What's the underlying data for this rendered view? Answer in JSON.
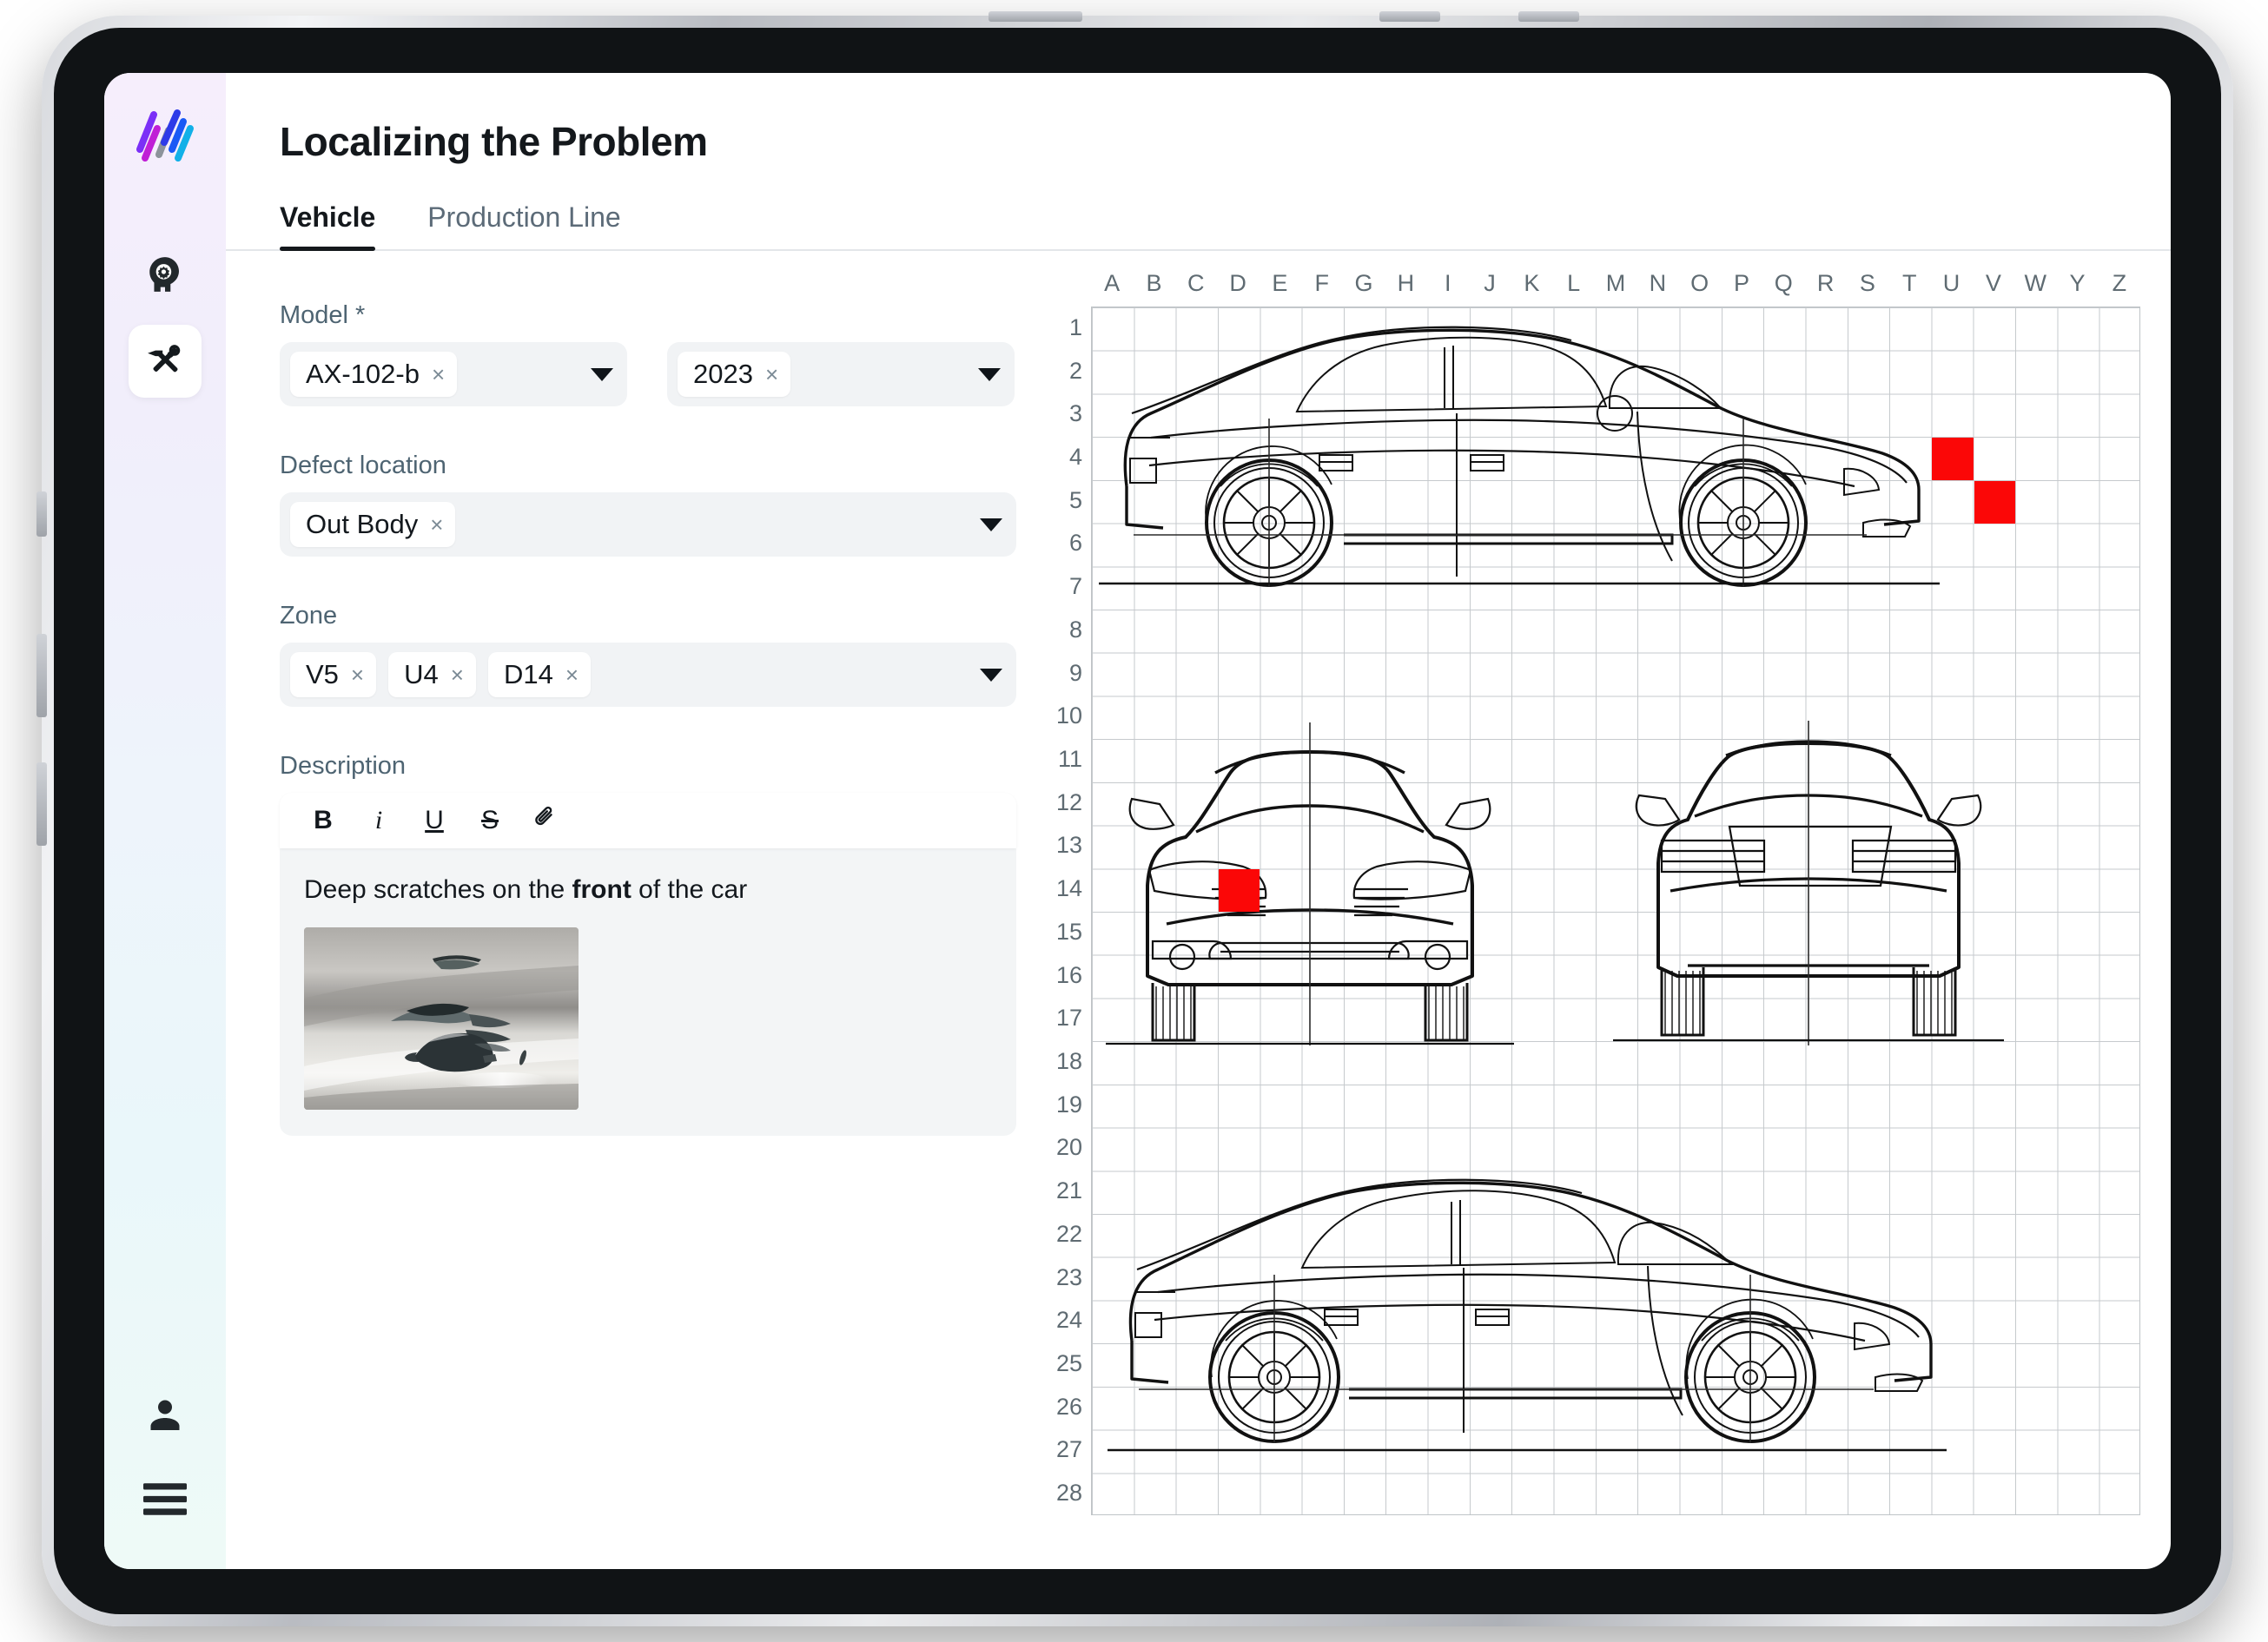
{
  "app": {
    "logo": "logo-mark",
    "page_title": "Localizing the Problem"
  },
  "sidebar": {
    "items": [
      {
        "name": "ai-assist",
        "icon": "head-gear-icon",
        "active": false
      },
      {
        "name": "tools",
        "icon": "tools-icon",
        "active": true
      },
      {
        "name": "account",
        "icon": "person-icon",
        "active": false
      },
      {
        "name": "menu",
        "icon": "hamburger-menu-icon",
        "active": false
      }
    ]
  },
  "tabs": [
    {
      "label": "Vehicle",
      "active": true
    },
    {
      "label": "Production Line",
      "active": false
    }
  ],
  "form": {
    "model": {
      "label": "Model *",
      "chips": [
        "AX-102-b"
      ],
      "remove_symbol": "×"
    },
    "year": {
      "label": "",
      "chips": [
        "2023"
      ],
      "remove_symbol": "×"
    },
    "defect_location": {
      "label": "Defect location",
      "chips": [
        "Out Body"
      ],
      "remove_symbol": "×"
    },
    "zone": {
      "label": "Zone",
      "chips": [
        "V5",
        "U4",
        "D14"
      ],
      "remove_symbol": "×"
    },
    "description": {
      "label": "Description",
      "toolbar": [
        {
          "name": "bold",
          "glyph": "B"
        },
        {
          "name": "italic",
          "glyph": "i"
        },
        {
          "name": "underline",
          "glyph": "U"
        },
        {
          "name": "strikethrough",
          "glyph": "S"
        },
        {
          "name": "attachment",
          "glyph": "attachment-icon"
        }
      ],
      "text_before": "Deep scratches on the ",
      "text_bold": "front",
      "text_after": " of the car",
      "attachment_alt": "scratched-car-panel-photo"
    }
  },
  "blueprint": {
    "columns": [
      "A",
      "B",
      "C",
      "D",
      "E",
      "F",
      "G",
      "H",
      "I",
      "J",
      "K",
      "L",
      "M",
      "N",
      "O",
      "P",
      "Q",
      "R",
      "S",
      "T",
      "U",
      "V",
      "W",
      "Y",
      "Z"
    ],
    "rows": [
      1,
      2,
      3,
      4,
      5,
      6,
      7,
      8,
      9,
      10,
      11,
      12,
      13,
      14,
      15,
      16,
      17,
      18,
      19,
      20,
      21,
      22,
      23,
      24,
      25,
      26,
      27,
      28
    ],
    "highlight_color": "#fb0707",
    "highlighted_cells": [
      {
        "col": "U",
        "row": 4,
        "view": "side-top"
      },
      {
        "col": "V",
        "row": 5,
        "view": "side-top"
      },
      {
        "col": "D",
        "row": 14,
        "view": "front"
      }
    ],
    "views": [
      {
        "name": "side-view-top",
        "label": ""
      },
      {
        "name": "front-view",
        "label": ""
      },
      {
        "name": "rear-view",
        "label": ""
      },
      {
        "name": "side-view-bottom",
        "label": ""
      }
    ]
  },
  "colors": {
    "accent_red": "#fb0707",
    "text_dark": "#14181c",
    "text_muted": "#4e6472",
    "field_bg": "#f1f3f5",
    "sidebar_top": "#f6eefc",
    "sidebar_bottom": "#eefaf7"
  }
}
